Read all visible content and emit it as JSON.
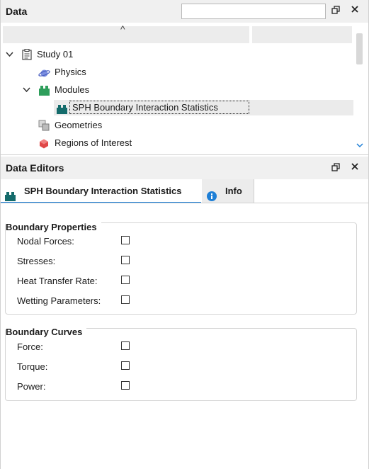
{
  "data_panel": {
    "title": "Data",
    "search": {
      "value": "",
      "placeholder": ""
    },
    "sort_indicator": "^",
    "tree": {
      "study": "Study 01",
      "physics": "Physics",
      "modules": "Modules",
      "selected_module": "SPH Boundary Interaction Statistics",
      "geometries": "Geometries",
      "regions": "Regions of Interest"
    }
  },
  "editors_panel": {
    "title": "Data Editors",
    "tabs": [
      {
        "label": "SPH Boundary Interaction Statistics",
        "active": true
      },
      {
        "label": "Info",
        "active": false
      }
    ]
  },
  "groups": {
    "boundary_properties": {
      "title": "Boundary Properties",
      "items": [
        {
          "label": "Nodal Forces:",
          "checked": false
        },
        {
          "label": "Stresses:",
          "checked": false
        },
        {
          "label": "Heat Transfer Rate:",
          "checked": false
        },
        {
          "label": "Wetting Parameters:",
          "checked": false
        }
      ]
    },
    "boundary_curves": {
      "title": "Boundary Curves",
      "items": [
        {
          "label": "Force:",
          "checked": false
        },
        {
          "label": "Torque:",
          "checked": false
        },
        {
          "label": "Power:",
          "checked": false
        }
      ]
    }
  },
  "colors": {
    "accent": "#1e7fd6",
    "module_green": "#2e9e5b",
    "module_teal": "#146b6b",
    "region_red": "#e04848"
  }
}
